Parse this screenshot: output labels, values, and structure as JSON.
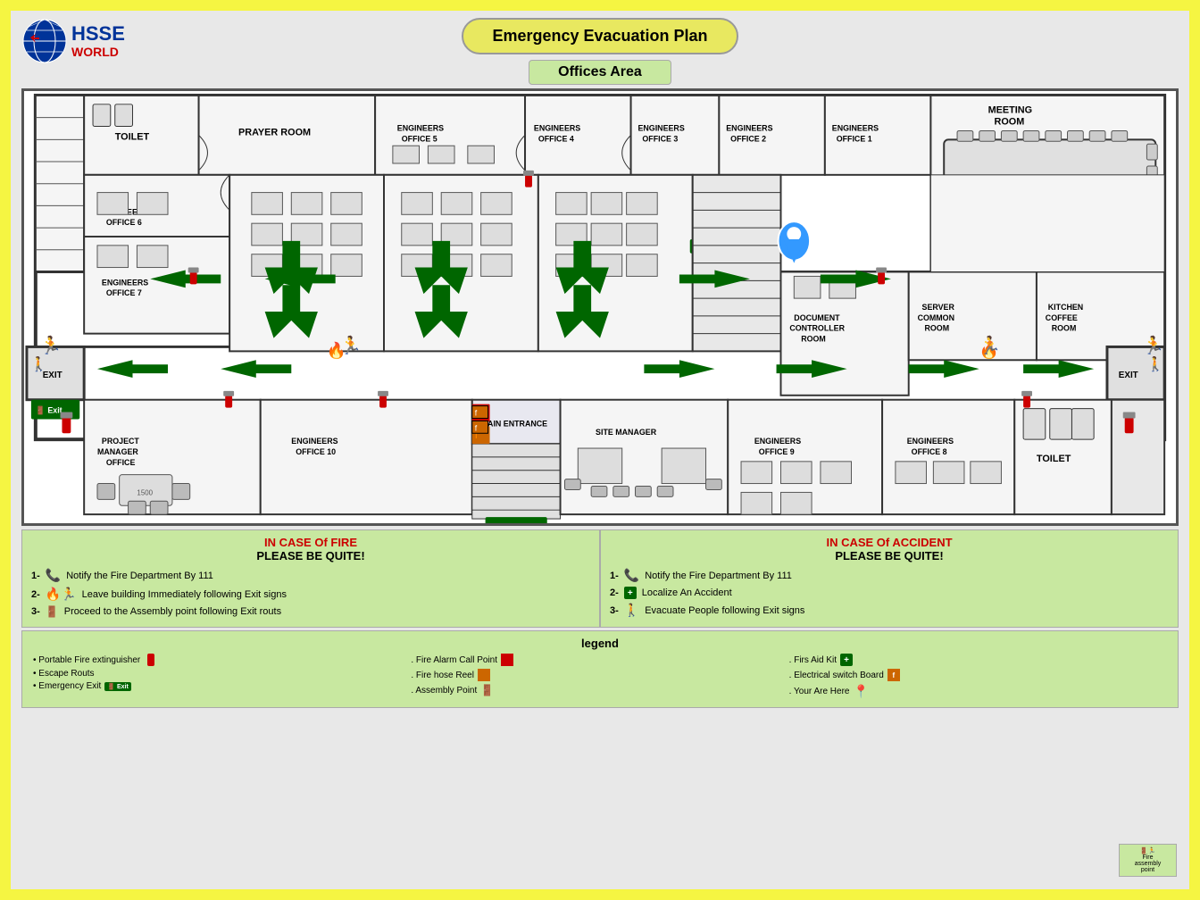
{
  "header": {
    "title": "Emergency  Evacuation Plan",
    "logo_text": "HSSE",
    "logo_sub": "WORLD",
    "offices_area": "Offices Area"
  },
  "rooms": [
    {
      "id": "prayer-room",
      "label": "PRAYER ROOM"
    },
    {
      "id": "engineers-5",
      "label": "ENGINEERS\nOFFICE 5"
    },
    {
      "id": "engineers-4",
      "label": "ENGINEERS\nOFFICE 4"
    },
    {
      "id": "engineers-3",
      "label": "ENGINEERS\nOFFICE 3"
    },
    {
      "id": "engineers-2",
      "label": "ENGINEERS\nOFFICE 2"
    },
    {
      "id": "engineers-1",
      "label": "ENGINEERS\nOFFICE 1"
    },
    {
      "id": "meeting-room",
      "label": "MEETING\nROOM"
    },
    {
      "id": "toilet-top",
      "label": "TOILET"
    },
    {
      "id": "engineers-6",
      "label": "ENGINEERS\nOFFICE 6"
    },
    {
      "id": "engineers-7",
      "label": "ENGINEERS\nOFFICE 7"
    },
    {
      "id": "document-controller",
      "label": "DOCUMENT\nCONTROLLER\nROOM"
    },
    {
      "id": "server-common",
      "label": "SERVER\nCOMMON\nROOM"
    },
    {
      "id": "kitchen-coffee",
      "label": "KITCHEN\nCOFFEE\nROOM"
    },
    {
      "id": "project-manager",
      "label": "PROJECT\nMANAGER\nOFFICE"
    },
    {
      "id": "engineers-10",
      "label": "ENGINEERS\nOFFICE 10"
    },
    {
      "id": "main-entrance",
      "label": "MAIN ENTRANCE"
    },
    {
      "id": "site-manager",
      "label": "SITE MANAGER"
    },
    {
      "id": "engineers-9",
      "label": "ENGINEERS\nOFFICE 9"
    },
    {
      "id": "engineers-8",
      "label": "ENGINEERS\nOFFICE 8"
    },
    {
      "id": "toilet-bottom",
      "label": "TOILET"
    }
  ],
  "fire_panel": {
    "title": "IN CASE Of FIRE",
    "subtitle": "PLEASE BE QUITE!",
    "items": [
      "Notify the Fire Department By 111",
      "Leave building Immediately following  Exit signs",
      "Proceed to the Assembly point  following Exit routs"
    ]
  },
  "accident_panel": {
    "title": "IN CASE Of ACCIDENT",
    "subtitle": "PLEASE BE QUITE!",
    "items": [
      "Notify the Fire Department By 111",
      "Localize An Accident",
      "Evacuate People following Exit signs"
    ]
  },
  "legend": {
    "title": "legend",
    "col1": [
      "• Portable Fire extinguisher",
      "• Escape Routs",
      "• Emergency Exit"
    ],
    "col2": [
      ". Fire Alarm Call Point",
      ". Fire hose Reel",
      ". Assembly Point"
    ],
    "col3": [
      ". Firs Aid Kit",
      ". Electrical switch Board",
      ". Your Are Here"
    ]
  },
  "exits": {
    "left_label": "EXIT",
    "right_label": "EXIT"
  },
  "colors": {
    "background": "#f5f542",
    "title_bg": "#e8e860",
    "offices_bg": "#c8e8a0",
    "panel_bg": "#c8e8a0",
    "arrow_green": "#006600",
    "fire_red": "#cc0000",
    "wall_dark": "#333333"
  }
}
